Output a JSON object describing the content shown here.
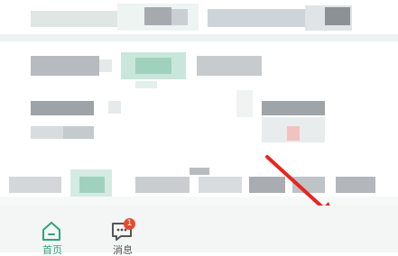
{
  "annotation": {
    "arrow_color": "#e8251f"
  },
  "tab_bar": {
    "tabs": [
      {
        "label": "首页",
        "icon": "home-icon",
        "active": true
      },
      {
        "label": "消息",
        "icon": "chat-icon",
        "badge": "1"
      }
    ]
  },
  "colors": {
    "accent": "#2fa37a",
    "badge": "#e8492f"
  }
}
